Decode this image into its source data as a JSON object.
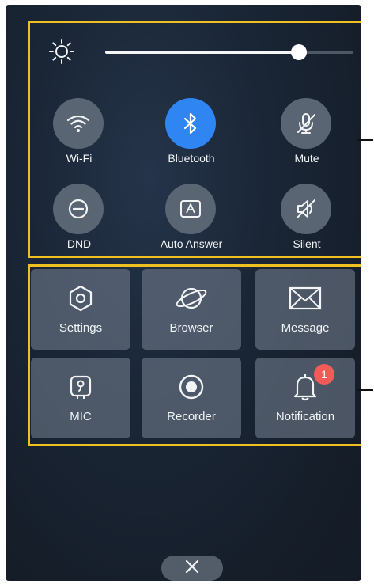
{
  "brightness": {
    "icon": "sun-icon",
    "level_percent": 78
  },
  "quick_toggles": [
    {
      "id": "wifi",
      "label": "Wi-Fi",
      "icon": "wifi-icon",
      "active": false
    },
    {
      "id": "bluetooth",
      "label": "Bluetooth",
      "icon": "bluetooth-icon",
      "active": true
    },
    {
      "id": "mute",
      "label": "Mute",
      "icon": "mic-off-icon",
      "active": false
    },
    {
      "id": "dnd",
      "label": "DND",
      "icon": "minus-circle-icon",
      "active": false
    },
    {
      "id": "auto_answer",
      "label": "Auto Answer",
      "icon": "auto-answer-icon",
      "active": false
    },
    {
      "id": "silent",
      "label": "Silent",
      "icon": "speaker-off-icon",
      "active": false
    }
  ],
  "app_tiles": [
    {
      "id": "settings",
      "label": "Settings",
      "icon": "hexagon-gear-icon"
    },
    {
      "id": "browser",
      "label": "Browser",
      "icon": "planet-icon"
    },
    {
      "id": "message",
      "label": "Message",
      "icon": "envelope-icon"
    },
    {
      "id": "mic",
      "label": "MIC",
      "icon": "mic-icon"
    },
    {
      "id": "recorder",
      "label": "Recorder",
      "icon": "record-icon"
    },
    {
      "id": "notification",
      "label": "Notification",
      "icon": "bell-icon",
      "badge": "1"
    }
  ],
  "close": {
    "icon": "close-icon"
  },
  "colors": {
    "highlight_frame": "#f0c020",
    "active_toggle": "#2f86f3",
    "badge": "#f25b57"
  }
}
